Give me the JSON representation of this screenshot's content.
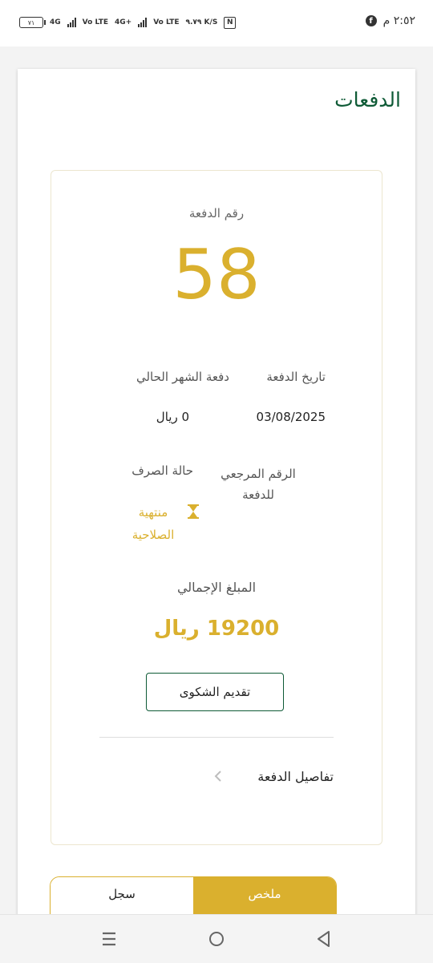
{
  "status_bar": {
    "time": "٢:٥٢ م",
    "battery": "٧١",
    "signal1_type": "4G",
    "signal1_volte": "Vo LTE",
    "signal2_type": "4G+",
    "signal2_volte": "Vo LTE",
    "net_speed": "٩.٧٩ K/S",
    "nfc_label": "N",
    "icons": [
      "battery-icon",
      "signal-icon",
      "signal-icon",
      "nfc-icon",
      "facebook-icon"
    ]
  },
  "page": {
    "title": "الدفعات"
  },
  "payment": {
    "number_label": "رقم الدفعة",
    "number": "58",
    "date_label": "تاريخ الدفعة",
    "date": "03/08/2025",
    "current_month_label": "دفعة الشهر الحالي",
    "current_month_value": "0 ريال",
    "reference_label": "الرقم المرجعي للدفعة",
    "disbursement_status_label": "حالة الصرف",
    "disbursement_status": "منتهية الصلاحية",
    "status_icon": "hourglass-icon",
    "total_label": "المبلغ الإجمالي",
    "total": "19200 ريال",
    "complaint_button": "تقديم الشكوى",
    "details_link": "تفاصيل الدفعة",
    "details_icon": "chevron-left-icon"
  },
  "tabs": [
    {
      "label": "ملخص",
      "active": true
    },
    {
      "label": "سجل",
      "active": false
    }
  ],
  "nav_bar": {
    "icons": [
      "back-icon",
      "home-icon",
      "recents-icon"
    ]
  },
  "colors": {
    "primary_green": "#0e5a36",
    "accent_gold": "#dab02e",
    "background": "#f3f3f3"
  }
}
